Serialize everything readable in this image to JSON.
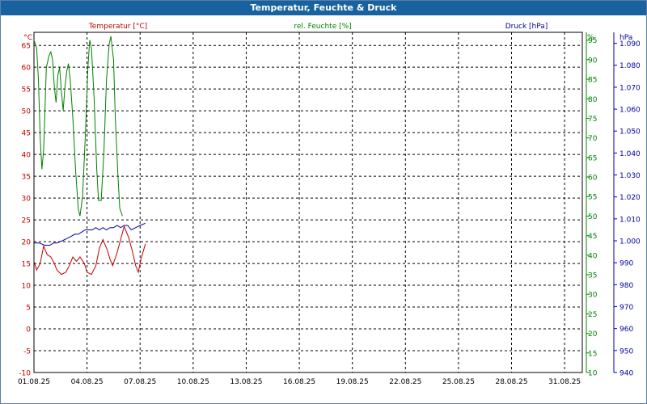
{
  "window": {
    "title": "Temperatur, Feuchte & Druck"
  },
  "colors": {
    "temperature": "#c00000",
    "humidity": "#008000",
    "pressure": "#0000a0",
    "titlebar": "#17629f"
  },
  "chart_data": {
    "type": "line",
    "title": "Temperatur, Feuchte & Druck",
    "grid": true,
    "x_ticks": [
      "01.08.25",
      "04.08.25",
      "07.08.25",
      "10.08.25",
      "13.08.25",
      "16.08.25",
      "19.08.25",
      "22.08.25",
      "25.08.25",
      "28.08.25",
      "31.08.25"
    ],
    "xlim_days": [
      1,
      32
    ],
    "axes": {
      "temperature": {
        "label": "Temperatur [°C]",
        "unit": "°C",
        "ylim": [
          -10,
          68
        ],
        "ticks": [
          "65",
          "60",
          "55",
          "50",
          "45",
          "40",
          "35",
          "30",
          "25",
          "20",
          "15",
          "10",
          "5",
          "0",
          "-5",
          "-10"
        ]
      },
      "humidity": {
        "label": "rel. Feuchte [%]",
        "unit": "%",
        "ylim": [
          10,
          97
        ],
        "ticks": [
          "95",
          "90",
          "85",
          "80",
          "75",
          "70",
          "65",
          "60",
          "55",
          "50",
          "45",
          "40",
          "35",
          "30",
          "25",
          "20",
          "15",
          "10"
        ]
      },
      "pressure": {
        "label": "Druck [hPa]",
        "unit": "hPa",
        "ylim": [
          0.94,
          1.095
        ],
        "ticks": [
          "1.090",
          "1.080",
          "1.070",
          "1.060",
          "1.050",
          "1.040",
          "1.030",
          "1.020",
          "1.010",
          "1.000",
          "990",
          "980",
          "970",
          "960",
          "950",
          "940"
        ]
      }
    },
    "series": [
      {
        "name": "Temperatur [°C]",
        "axis": "temperature",
        "points": [
          [
            1.0,
            15.5
          ],
          [
            1.15,
            13.5
          ],
          [
            1.35,
            15
          ],
          [
            1.55,
            19
          ],
          [
            1.75,
            17
          ],
          [
            1.95,
            16.5
          ],
          [
            2.15,
            15
          ],
          [
            2.3,
            13.5
          ],
          [
            2.55,
            12.5
          ],
          [
            2.8,
            13
          ],
          [
            3.0,
            14.5
          ],
          [
            3.2,
            16.5
          ],
          [
            3.4,
            15.5
          ],
          [
            3.6,
            16.5
          ],
          [
            3.85,
            15
          ],
          [
            4.0,
            13
          ],
          [
            4.25,
            12.5
          ],
          [
            4.5,
            14.5
          ],
          [
            4.7,
            18.5
          ],
          [
            4.9,
            20.5
          ],
          [
            5.15,
            18
          ],
          [
            5.3,
            16
          ],
          [
            5.45,
            14.5
          ],
          [
            5.7,
            17.5
          ],
          [
            5.9,
            20.5
          ],
          [
            6.1,
            23.5
          ],
          [
            6.35,
            21
          ],
          [
            6.55,
            18
          ],
          [
            6.75,
            14.5
          ],
          [
            6.9,
            13
          ],
          [
            7.05,
            16
          ],
          [
            7.3,
            19.5
          ]
        ]
      },
      {
        "name": "rel. Feuchte [%]",
        "axis": "humidity",
        "points": [
          [
            1.0,
            95
          ],
          [
            1.15,
            93
          ],
          [
            1.25,
            85
          ],
          [
            1.35,
            70
          ],
          [
            1.45,
            62
          ],
          [
            1.55,
            67
          ],
          [
            1.7,
            88
          ],
          [
            1.85,
            91
          ],
          [
            1.95,
            92
          ],
          [
            2.05,
            90
          ],
          [
            2.15,
            83
          ],
          [
            2.25,
            79
          ],
          [
            2.35,
            86
          ],
          [
            2.45,
            88
          ],
          [
            2.55,
            82
          ],
          [
            2.65,
            77
          ],
          [
            2.75,
            83
          ],
          [
            2.85,
            87
          ],
          [
            2.95,
            89
          ],
          [
            3.05,
            85
          ],
          [
            3.2,
            75
          ],
          [
            3.35,
            62
          ],
          [
            3.5,
            52
          ],
          [
            3.6,
            50
          ],
          [
            3.75,
            55
          ],
          [
            3.9,
            70
          ],
          [
            4.05,
            88
          ],
          [
            4.15,
            95
          ],
          [
            4.25,
            93
          ],
          [
            4.4,
            80
          ],
          [
            4.55,
            62
          ],
          [
            4.65,
            54
          ],
          [
            4.8,
            54
          ],
          [
            4.95,
            66
          ],
          [
            5.1,
            85
          ],
          [
            5.25,
            94
          ],
          [
            5.35,
            96
          ],
          [
            5.5,
            90
          ],
          [
            5.6,
            75
          ],
          [
            5.75,
            60
          ],
          [
            5.85,
            52
          ],
          [
            6.0,
            50
          ]
        ]
      },
      {
        "name": "Druck [hPa]",
        "axis": "pressure",
        "points": [
          [
            1.0,
            0.999
          ],
          [
            1.3,
            0.999
          ],
          [
            1.6,
            0.998
          ],
          [
            1.9,
            0.998
          ],
          [
            2.1,
            0.999
          ],
          [
            2.3,
            0.999
          ],
          [
            2.6,
            1.0
          ],
          [
            2.85,
            1.001
          ],
          [
            3.1,
            1.002
          ],
          [
            3.3,
            1.003
          ],
          [
            3.5,
            1.003
          ],
          [
            3.7,
            1.004
          ],
          [
            3.9,
            1.005
          ],
          [
            4.1,
            1.005
          ],
          [
            4.3,
            1.005
          ],
          [
            4.5,
            1.006
          ],
          [
            4.7,
            1.005
          ],
          [
            4.9,
            1.006
          ],
          [
            5.1,
            1.005
          ],
          [
            5.3,
            1.006
          ],
          [
            5.5,
            1.006
          ],
          [
            5.7,
            1.007
          ],
          [
            5.9,
            1.006
          ],
          [
            6.1,
            1.007
          ],
          [
            6.3,
            1.007
          ],
          [
            6.5,
            1.005
          ],
          [
            6.75,
            1.006
          ],
          [
            7.0,
            1.007
          ],
          [
            7.3,
            1.008
          ]
        ]
      }
    ]
  }
}
